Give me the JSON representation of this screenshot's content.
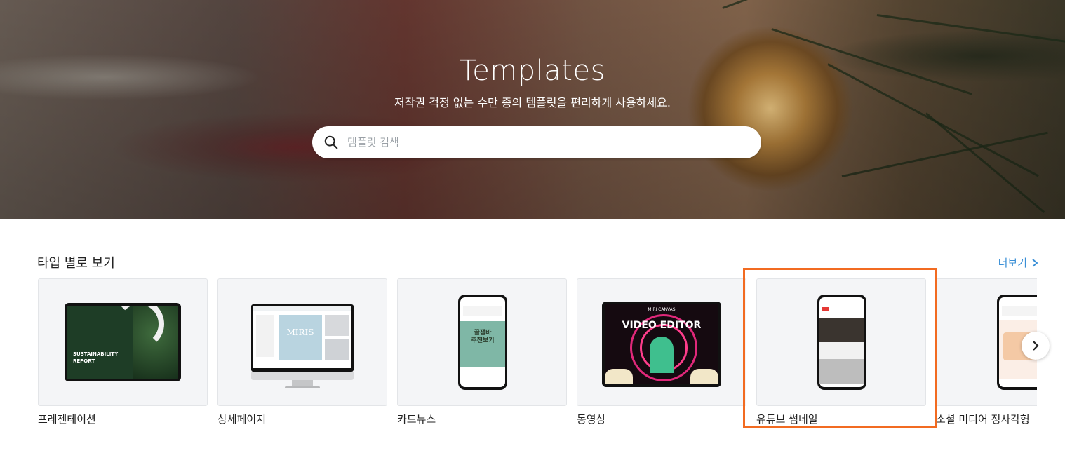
{
  "hero": {
    "title": "Templates",
    "subtitle": "저작권 걱정 없는 수만 종의 템플릿을 편리하게 사용하세요.",
    "search_placeholder": "템플릿 검색"
  },
  "section": {
    "title": "타입 별로 보기",
    "more_label": "더보기"
  },
  "cards": [
    {
      "label": "프레젠테이션",
      "thumb_text": [
        "SUSTAINABILITY",
        "REPORT"
      ]
    },
    {
      "label": "상세페이지",
      "thumb_text": [
        "MIRIS"
      ]
    },
    {
      "label": "카드뉴스",
      "thumb_text": [
        "꿀잼바",
        "추천보기"
      ]
    },
    {
      "label": "동영상",
      "thumb_text": [
        "MIRI CANVAS",
        "VIDEO EDITOR"
      ]
    },
    {
      "label": "유튜브 썸네일"
    },
    {
      "label": "소셜 미디어 정사각형"
    }
  ],
  "colors": {
    "highlight": "#f26b21",
    "link": "#3a8fd6"
  }
}
